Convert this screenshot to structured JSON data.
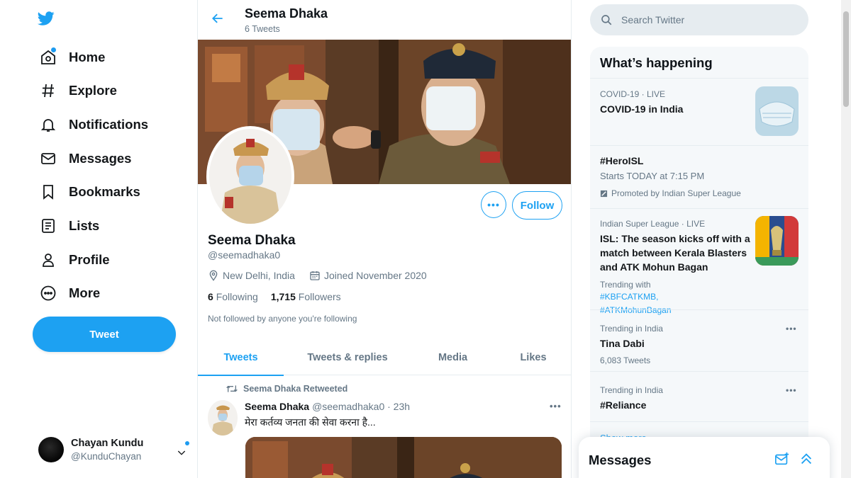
{
  "nav": {
    "items": [
      {
        "label": "Home",
        "icon": "home-icon"
      },
      {
        "label": "Explore",
        "icon": "hashtag-icon"
      },
      {
        "label": "Notifications",
        "icon": "bell-icon"
      },
      {
        "label": "Messages",
        "icon": "envelope-icon"
      },
      {
        "label": "Bookmarks",
        "icon": "bookmark-icon"
      },
      {
        "label": "Lists",
        "icon": "list-icon"
      },
      {
        "label": "Profile",
        "icon": "person-icon"
      },
      {
        "label": "More",
        "icon": "more-circle-icon"
      }
    ],
    "tweet_button": "Tweet",
    "account": {
      "name": "Chayan Kundu",
      "handle": "@KunduChayan"
    }
  },
  "header": {
    "title": "Seema Dhaka",
    "subtitle": "6 Tweets"
  },
  "profile": {
    "name": "Seema Dhaka",
    "handle": "@seemadhaka0",
    "location": "New Delhi, India",
    "joined": "Joined November 2020",
    "following_count": "6",
    "following_label": "Following",
    "followers_count": "1,715",
    "followers_label": "Followers",
    "not_followed": "Not followed by anyone you're following",
    "follow_button": "Follow",
    "more_button": "•••"
  },
  "tabs": [
    "Tweets",
    "Tweets & replies",
    "Media",
    "Likes"
  ],
  "tweet": {
    "retweet_note": "Seema Dhaka Retweeted",
    "author": "Seema Dhaka",
    "handle_time": "@seemadhaka0 · 23h",
    "text": "मेरा कर्तव्य जनता की सेवा करना है...",
    "more": "•••"
  },
  "search": {
    "placeholder": "Search Twitter"
  },
  "trends": {
    "title": "What’s happening",
    "items": [
      {
        "meta": "COVID-19 · LIVE",
        "main": "COVID-19 in India"
      },
      {
        "main": "#HeroISL",
        "sub": "Starts TODAY at 7:15 PM",
        "promo": "Promoted by Indian Super League"
      },
      {
        "meta": "Indian Super League · LIVE",
        "main": "ISL: The season kicks off with a match between Kerala Blasters and ATK Mohun Bagan",
        "trend_with": "Trending with",
        "links": "#KBFCATKMB, #ATKMohunBagan"
      },
      {
        "meta": "Trending in India",
        "main": "Tina Dabi",
        "sub": "6,083 Tweets"
      },
      {
        "meta": "Trending in India",
        "main": "#Reliance"
      }
    ],
    "show_more": "Show more"
  },
  "messages_drawer": {
    "title": "Messages"
  },
  "colors": {
    "accent": "#1da1f2",
    "text": "#14171a",
    "muted": "#657786",
    "border": "#e6ecf0"
  }
}
